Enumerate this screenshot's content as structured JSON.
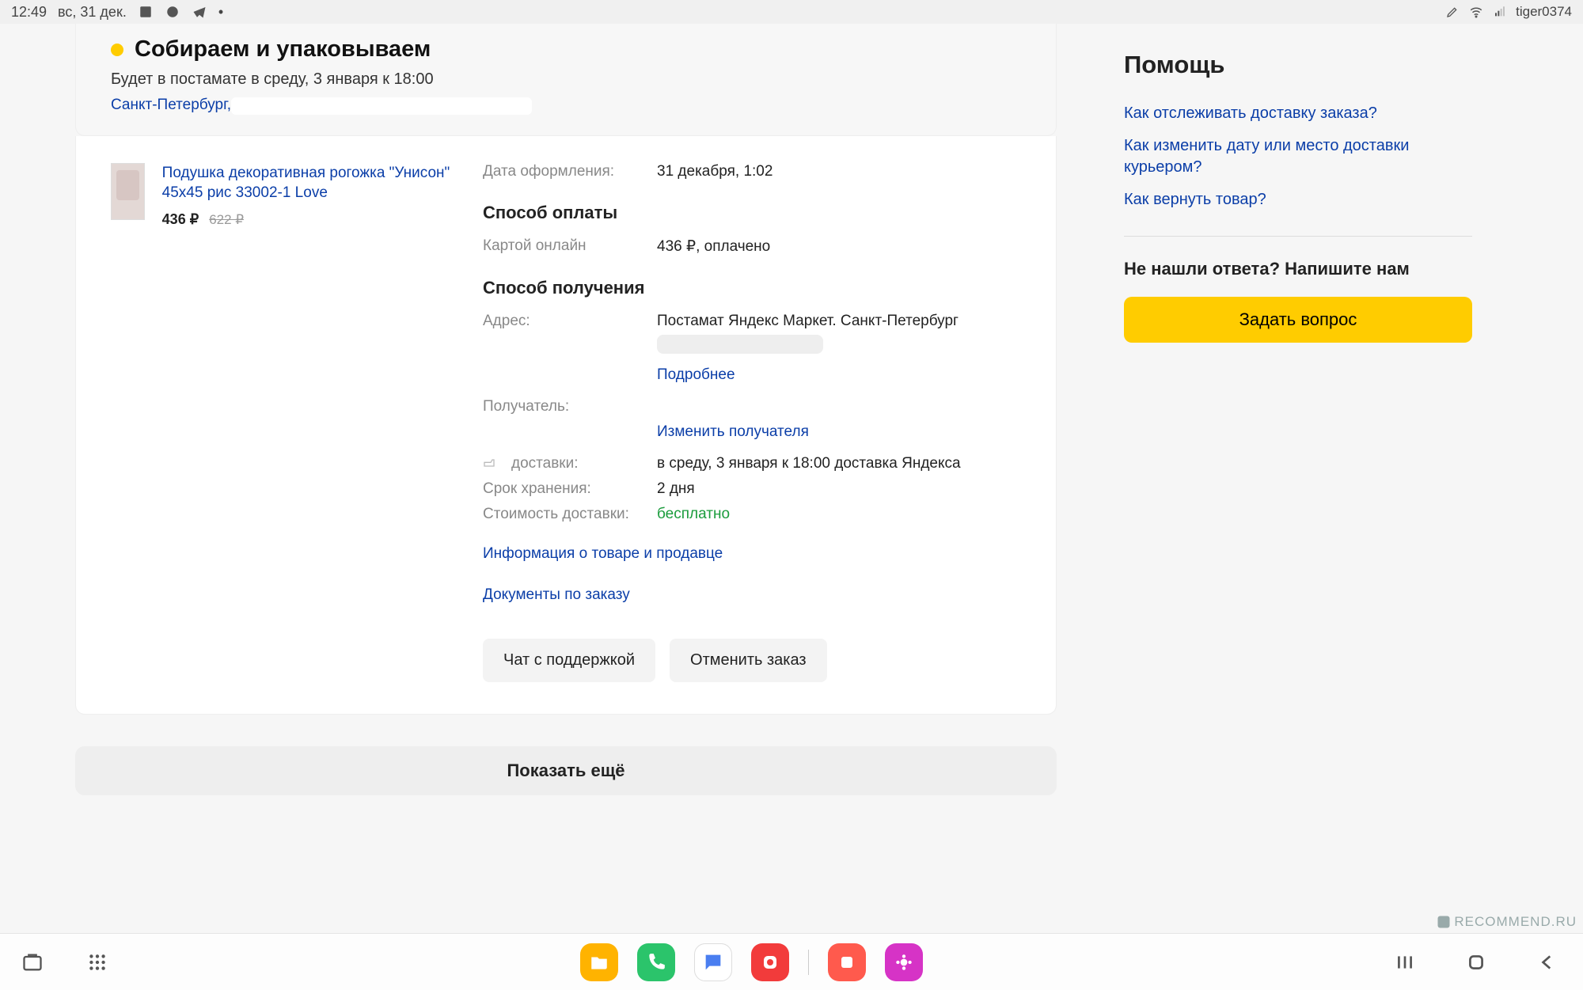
{
  "statusbar": {
    "time": "12:49",
    "date": "вс, 31 дек.",
    "user": "tiger0374"
  },
  "order": {
    "status_title": "Собираем и упаковываем",
    "status_sub": "Будет в постамате в среду, 3 января к 18:00",
    "city": "Санкт-Петербург,",
    "product": {
      "name": "Подушка декоративная рогожка \"Унисон\" 45х45 рис 33002-1 Love",
      "price": "436 ₽",
      "old_price": "622 ₽"
    },
    "details": {
      "order_date_label": "Дата оформления:",
      "order_date_value": "31 декабря, 1:02",
      "payment_header": "Способ оплаты",
      "payment_method_label": "Картой онлайн",
      "payment_value": "436 ₽, оплачено",
      "delivery_header": "Способ получения",
      "address_label": "Адрес:",
      "address_value": "Постамат Яндекс Маркет. Санкт-Петербург",
      "address_more": "Подробнее",
      "recipient_label": "Получатель:",
      "recipient_change": "Изменить получателя",
      "delivery_date_label": "доставки:",
      "delivery_date_value": "в среду, 3 января к 18:00 доставка Яндекса",
      "storage_label": "Срок хранения:",
      "storage_value": "2 дня",
      "cost_label": "Стоимость доставки:",
      "cost_value": "бесплатно",
      "info_link": "Информация о товаре и продавце",
      "docs_link": "Документы по заказу",
      "support_btn": "Чат с поддержкой",
      "cancel_btn": "Отменить заказ"
    }
  },
  "show_more": "Показать ещё",
  "sidebar": {
    "title": "Помощь",
    "links": [
      "Как отслеживать доставку заказа?",
      "Как изменить дату или место доставки курьером?",
      "Как вернуть товар?"
    ],
    "subtitle": "Не нашли ответа? Напишите нам",
    "ask_btn": "Задать вопрос"
  },
  "watermark": "RECOMMEND.RU"
}
